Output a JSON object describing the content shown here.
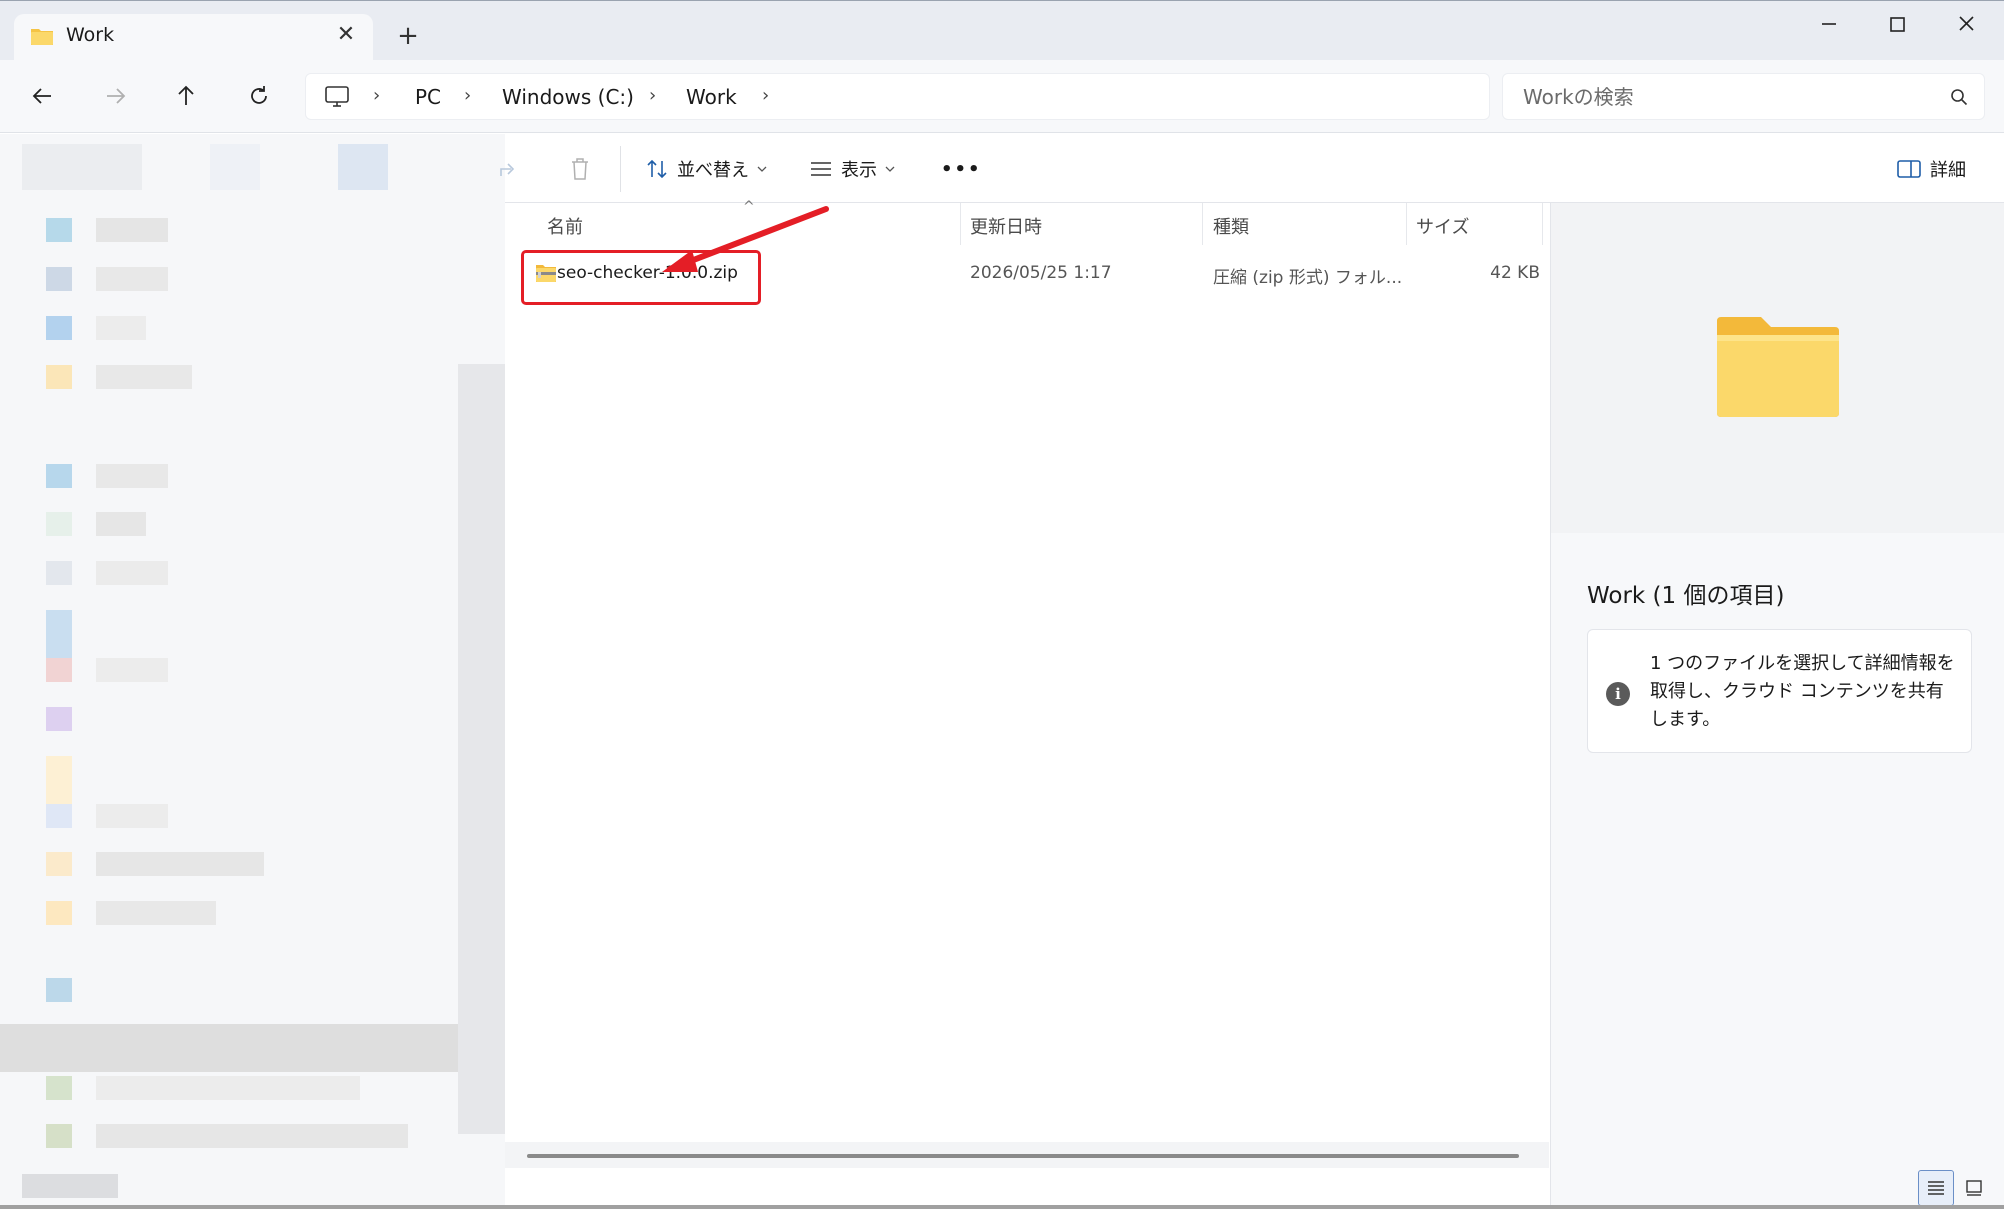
{
  "window": {
    "tab_title": "Work",
    "new_tab_symbol": "+",
    "close_tab_symbol": "✕"
  },
  "address": {
    "breadcrumbs": [
      "PC",
      "Windows (C:)",
      "Work"
    ],
    "separator": "›"
  },
  "search": {
    "placeholder": "Workの検索"
  },
  "toolbar": {
    "sort_label": "並べ替え",
    "view_label": "表示",
    "more_label": "•••",
    "details_label": "詳細"
  },
  "file_list": {
    "columns": [
      "名前",
      "更新日時",
      "種類",
      "サイズ"
    ],
    "rows": [
      {
        "name": "seo-checker-1.0.0.zip",
        "modified": "2026/05/25 1:17",
        "type": "圧縮 (zip 形式) フォル...",
        "size": "42 KB"
      }
    ]
  },
  "details_pane": {
    "title": "Work (1 個の項目)",
    "info": "1 つのファイルを選択して詳細情報を取得し、クラウド コンテンツを共有します。",
    "info_icon": "i"
  },
  "colors": {
    "accent": "#0067c0",
    "highlight": "#e41e26",
    "folder": "#f9d867"
  }
}
